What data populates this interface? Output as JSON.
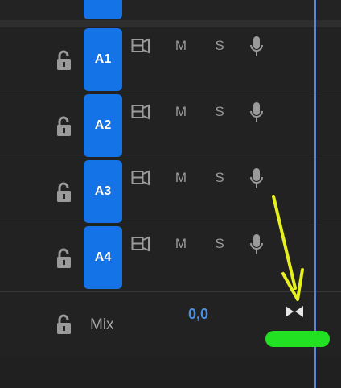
{
  "tracks": [
    {
      "label": "A1",
      "mute": "M",
      "solo": "S"
    },
    {
      "label": "A2",
      "mute": "M",
      "solo": "S"
    },
    {
      "label": "A3",
      "mute": "M",
      "solo": "S"
    },
    {
      "label": "A4",
      "mute": "M",
      "solo": "S"
    }
  ],
  "mix": {
    "label": "Mix",
    "value": "0,0"
  },
  "colors": {
    "track_label_blue": "#1473e6",
    "mix_value_blue": "#4a90e2",
    "playhead": "#5a86d4",
    "annotation_arrow": "#e6f01e",
    "annotation_marker": "#22e022"
  },
  "icons": [
    "lock-icon",
    "sync-lock-icon",
    "microphone-icon",
    "bowtie-icon"
  ]
}
